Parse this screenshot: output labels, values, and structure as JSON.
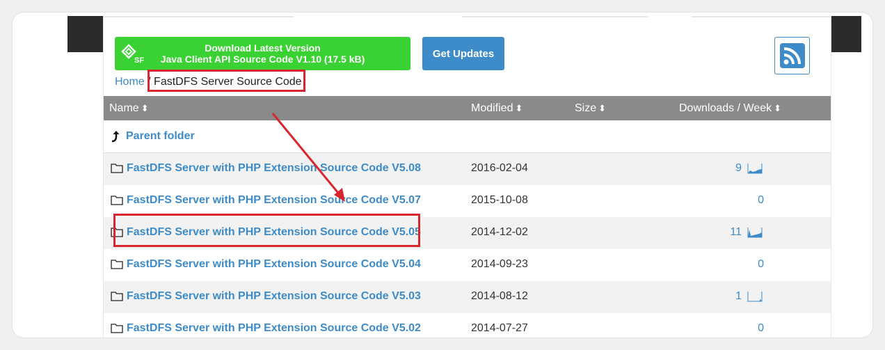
{
  "download": {
    "line1": "Download Latest Version",
    "line2": "Java Client API Source Code V1.10 (17.5 kB)",
    "logo_text": "SF"
  },
  "updates_label": "Get Updates",
  "breadcrumb": {
    "home": "Home",
    "separator": "/",
    "current": "FastDFS Server Source Code"
  },
  "table": {
    "headers": {
      "name": "Name",
      "modified": "Modified",
      "size": "Size",
      "downloads": "Downloads / Week",
      "sort_glyph": "⬍"
    },
    "parent_folder": "Parent folder",
    "rows": [
      {
        "name": "FastDFS Server with PHP Extension Source Code V5.08",
        "modified": "2016-02-04",
        "downloads": "9",
        "spark": true
      },
      {
        "name": "FastDFS Server with PHP Extension Source Code V5.07",
        "modified": "2015-10-08",
        "downloads": "0",
        "spark": false
      },
      {
        "name": "FastDFS Server with PHP Extension Source Code V5.05",
        "modified": "2014-12-02",
        "downloads": "11",
        "spark": true
      },
      {
        "name": "FastDFS Server with PHP Extension Source Code V5.04",
        "modified": "2014-09-23",
        "downloads": "0",
        "spark": false
      },
      {
        "name": "FastDFS Server with PHP Extension Source Code V5.03",
        "modified": "2014-08-12",
        "downloads": "1",
        "spark": true
      },
      {
        "name": "FastDFS Server with PHP Extension Source Code V5.02",
        "modified": "2014-07-27",
        "downloads": "0",
        "spark": false
      }
    ]
  },
  "colors": {
    "download_green": "#3ad132",
    "link_blue": "#3d8bc9",
    "header_gray": "#8a8a8a",
    "annotation_red": "#d7262c"
  },
  "icons": [
    "sf-logo-icon",
    "rss-icon",
    "sort-icon",
    "parent-folder-arrow-icon",
    "folder-icon",
    "sparkline-icon"
  ]
}
